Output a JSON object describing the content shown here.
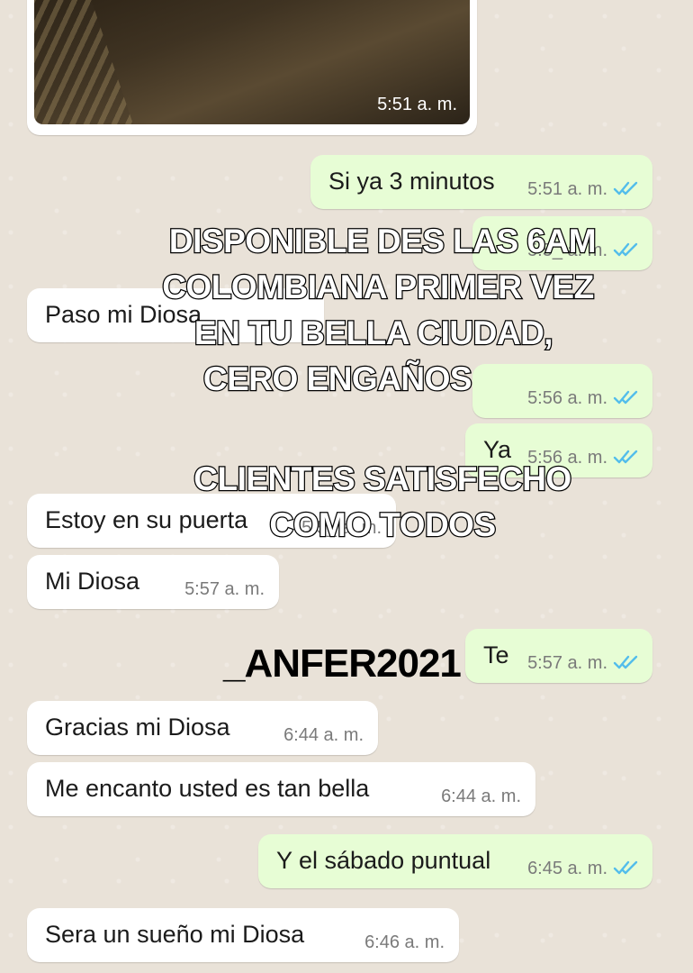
{
  "photo_message": {
    "time": "5:51 a. m."
  },
  "messages": [
    {
      "dir": "out",
      "text": "Si ya 3 minutos",
      "time": "5:51 a. m."
    },
    {
      "dir": "out",
      "text": "",
      "time": "5:5_ a. m."
    },
    {
      "dir": "in",
      "text": "Paso mi Diosa",
      "time": ""
    },
    {
      "dir": "out",
      "text": "",
      "time": "5:56 a. m."
    },
    {
      "dir": "out",
      "text": "Ya",
      "time": "5:56 a. m."
    },
    {
      "dir": "in",
      "text": "Estoy en su puerta",
      "time": "5:5_ a. m."
    },
    {
      "dir": "in",
      "text": "Mi Diosa",
      "time": "5:57 a. m."
    },
    {
      "dir": "out",
      "text": "Te",
      "time": "5:57 a. m."
    },
    {
      "dir": "in",
      "text": "Gracias mi Diosa",
      "time": "6:44 a. m."
    },
    {
      "dir": "in",
      "text": "Me encanto usted es tan bella",
      "time": "6:44 a. m."
    },
    {
      "dir": "out",
      "text": "Y el sábado puntual",
      "time": "6:45 a. m."
    },
    {
      "dir": "in",
      "text": "Sera un sueño mi Diosa",
      "time": "6:46 a. m."
    }
  ],
  "overlay": {
    "line1": "DISPONIBLE DES LAS 6AM",
    "line2": "COLOMBIANA PRIMER VEZ",
    "line3": "EN TU BELLA CIUDAD,",
    "line4": "CERO ENGAÑOS",
    "line5": "CLIENTES SATISFECHO",
    "line6": "COMO  TODOS",
    "handle": "_ANFER2021"
  },
  "colors": {
    "wallpaper": "#e9e2d8",
    "incoming": "#ffffff",
    "outgoing": "#e7fdd5",
    "read_ticks": "#53bdeb"
  },
  "icons": {
    "read_receipt": "double-check-icon"
  }
}
